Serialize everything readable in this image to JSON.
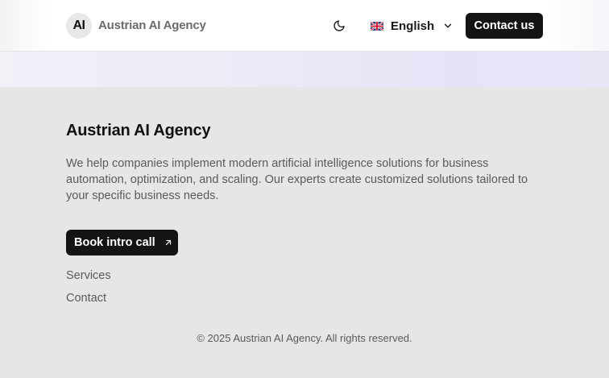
{
  "header": {
    "logo_text": "AI",
    "brand_name": "Austrian AI Agency",
    "theme_toggle_icon": "moon-icon",
    "language": {
      "label": "English",
      "flag_icon": "uk-flag-icon",
      "chevron_icon": "chevron-down-icon"
    },
    "contact_label": "Contact us"
  },
  "footer": {
    "title": "Austrian AI Agency",
    "description": "We help companies implement modern artificial intelligence solutions for business automation, optimization, and scaling. Our experts create customized solutions tailored to your specific business needs.",
    "cta_label": "Book intro call",
    "cta_icon": "arrow-up-right-icon",
    "links": [
      "Services",
      "Contact"
    ],
    "copyright": "© 2025 Austrian AI Agency. All rights reserved."
  },
  "colors": {
    "button_bg": "#141414",
    "footer_bg": "#e6e6e6",
    "muted_text": "#5a5a5a"
  }
}
